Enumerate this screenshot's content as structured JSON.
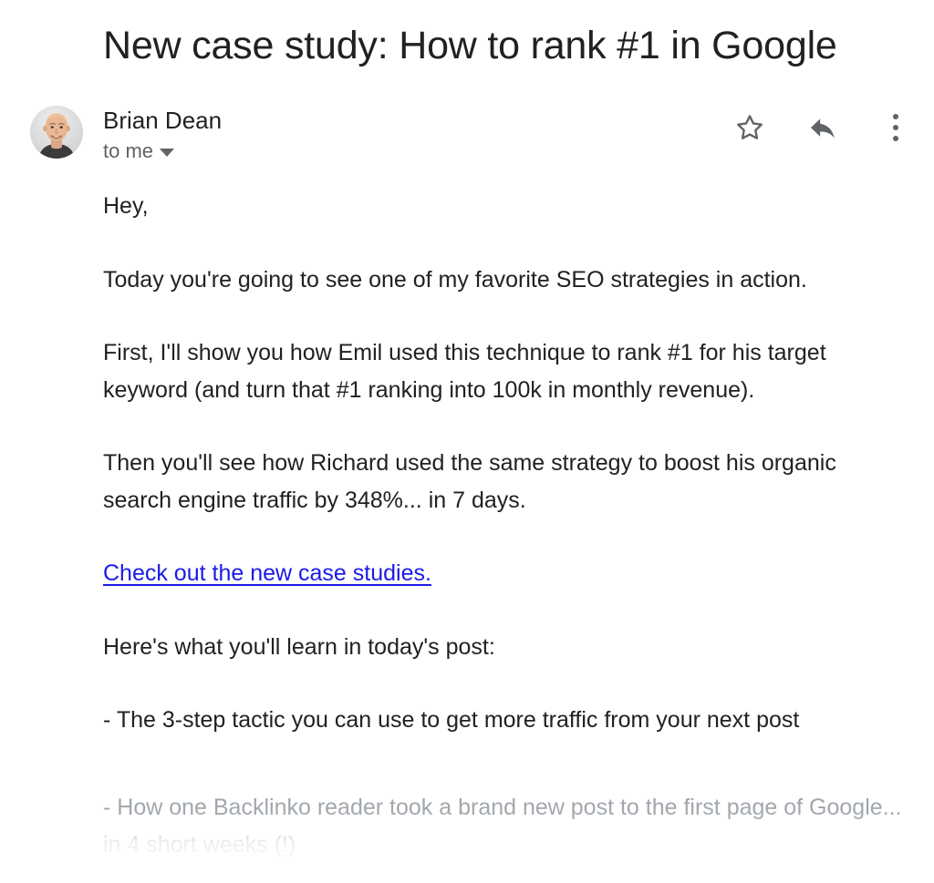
{
  "subject": "New case study: How to rank #1 in Google",
  "sender": {
    "name": "Brian Dean",
    "recipient": "to me",
    "avatar_icon": "avatar-photo",
    "caret_icon": "chevron-down-icon"
  },
  "actions": {
    "star": "star-outline-icon",
    "reply": "reply-arrow-icon",
    "more": "more-vertical-icon"
  },
  "body": {
    "greeting": "Hey,",
    "para_intro": "Today you're going to see one of my favorite SEO strategies in action.",
    "para_first": "First, I'll show you how Emil used this technique to rank #1 for his target keyword (and turn that #1 ranking into 100k in monthly revenue).",
    "para_then": "Then you'll see how Richard used the same strategy to boost his organic search engine traffic by 348%... in 7 days.",
    "link_text": "Check out the new case studies.",
    "para_learn": "Here's what you'll learn in today's post:",
    "bullet_one": "- The 3-step tactic you can use to get more traffic from your next post",
    "bullet_two": "- How one Backlinko reader took a brand new post to the first page of Google... in 4 short weeks (!)"
  },
  "colors": {
    "text": "#202124",
    "muted": "#5f6368",
    "link": "#1a1ae6",
    "faded": "#9aa0a6",
    "background": "#ffffff"
  }
}
